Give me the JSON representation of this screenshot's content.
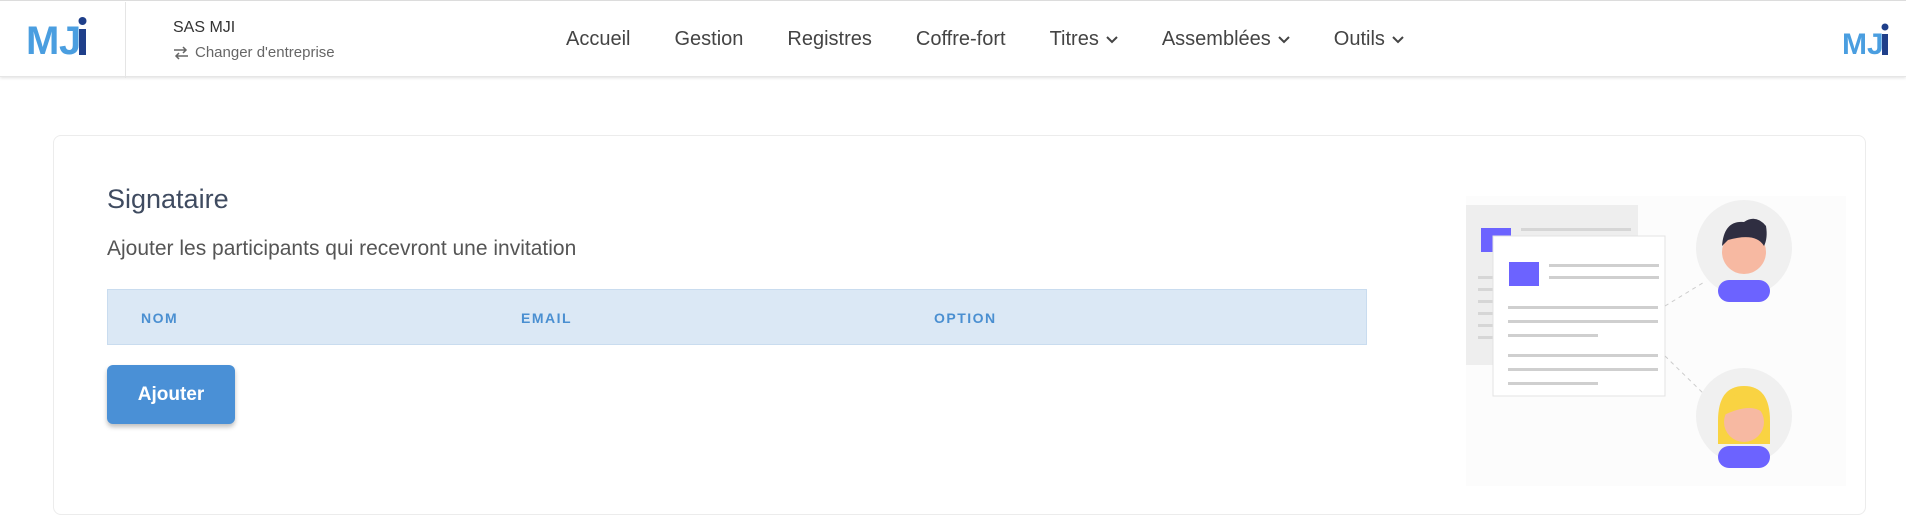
{
  "header": {
    "logo_text": "MJi",
    "company_name": "SAS MJI",
    "switch_company_label": "Changer d'entreprise",
    "right_logo_text": "MJi"
  },
  "nav": {
    "items": [
      {
        "label": "Accueil",
        "dropdown": false
      },
      {
        "label": "Gestion",
        "dropdown": false
      },
      {
        "label": "Registres",
        "dropdown": false
      },
      {
        "label": "Coffre-fort",
        "dropdown": false
      },
      {
        "label": "Titres",
        "dropdown": true
      },
      {
        "label": "Assemblées",
        "dropdown": true
      },
      {
        "label": "Outils",
        "dropdown": true
      }
    ]
  },
  "main": {
    "title": "Signataire",
    "subtitle": "Ajouter les participants qui recevront une invitation",
    "table_headers": [
      "NOM",
      "EMAIL",
      "OPTION"
    ],
    "add_button_label": "Ajouter"
  },
  "colors": {
    "accent": "#4a90d6",
    "table_header_bg": "#dbe8f5",
    "table_header_text": "#4a8fd1",
    "logo_light": "#4a9ee0",
    "logo_dark": "#1f3f8a",
    "illustration_purple": "#6c63ff"
  },
  "icons": {
    "switch": "swap-arrows-icon",
    "dropdown": "chevron-down-icon"
  }
}
